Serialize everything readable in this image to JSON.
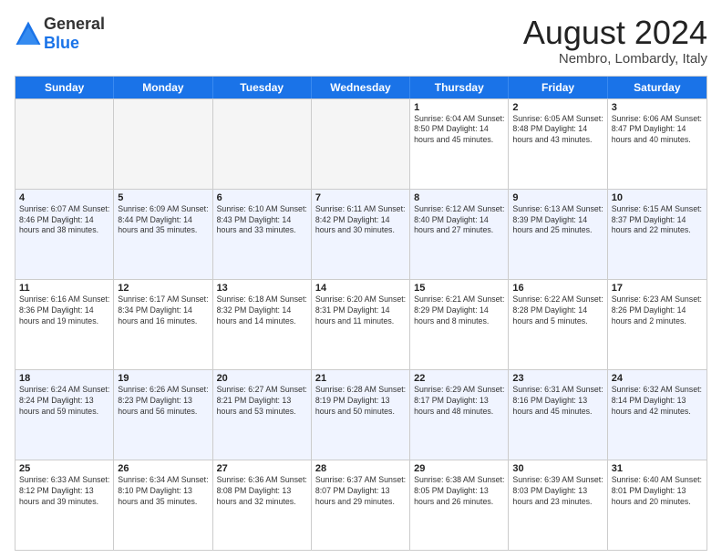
{
  "logo": {
    "general": "General",
    "blue": "Blue"
  },
  "title": "August 2024",
  "location": "Nembro, Lombardy, Italy",
  "days": [
    "Sunday",
    "Monday",
    "Tuesday",
    "Wednesday",
    "Thursday",
    "Friday",
    "Saturday"
  ],
  "rows": [
    [
      {
        "day": "",
        "info": "",
        "empty": true
      },
      {
        "day": "",
        "info": "",
        "empty": true
      },
      {
        "day": "",
        "info": "",
        "empty": true
      },
      {
        "day": "",
        "info": "",
        "empty": true
      },
      {
        "day": "1",
        "info": "Sunrise: 6:04 AM\nSunset: 8:50 PM\nDaylight: 14 hours\nand 45 minutes."
      },
      {
        "day": "2",
        "info": "Sunrise: 6:05 AM\nSunset: 8:48 PM\nDaylight: 14 hours\nand 43 minutes."
      },
      {
        "day": "3",
        "info": "Sunrise: 6:06 AM\nSunset: 8:47 PM\nDaylight: 14 hours\nand 40 minutes."
      }
    ],
    [
      {
        "day": "4",
        "info": "Sunrise: 6:07 AM\nSunset: 8:46 PM\nDaylight: 14 hours\nand 38 minutes."
      },
      {
        "day": "5",
        "info": "Sunrise: 6:09 AM\nSunset: 8:44 PM\nDaylight: 14 hours\nand 35 minutes."
      },
      {
        "day": "6",
        "info": "Sunrise: 6:10 AM\nSunset: 8:43 PM\nDaylight: 14 hours\nand 33 minutes."
      },
      {
        "day": "7",
        "info": "Sunrise: 6:11 AM\nSunset: 8:42 PM\nDaylight: 14 hours\nand 30 minutes."
      },
      {
        "day": "8",
        "info": "Sunrise: 6:12 AM\nSunset: 8:40 PM\nDaylight: 14 hours\nand 27 minutes."
      },
      {
        "day": "9",
        "info": "Sunrise: 6:13 AM\nSunset: 8:39 PM\nDaylight: 14 hours\nand 25 minutes."
      },
      {
        "day": "10",
        "info": "Sunrise: 6:15 AM\nSunset: 8:37 PM\nDaylight: 14 hours\nand 22 minutes."
      }
    ],
    [
      {
        "day": "11",
        "info": "Sunrise: 6:16 AM\nSunset: 8:36 PM\nDaylight: 14 hours\nand 19 minutes."
      },
      {
        "day": "12",
        "info": "Sunrise: 6:17 AM\nSunset: 8:34 PM\nDaylight: 14 hours\nand 16 minutes."
      },
      {
        "day": "13",
        "info": "Sunrise: 6:18 AM\nSunset: 8:32 PM\nDaylight: 14 hours\nand 14 minutes."
      },
      {
        "day": "14",
        "info": "Sunrise: 6:20 AM\nSunset: 8:31 PM\nDaylight: 14 hours\nand 11 minutes."
      },
      {
        "day": "15",
        "info": "Sunrise: 6:21 AM\nSunset: 8:29 PM\nDaylight: 14 hours\nand 8 minutes."
      },
      {
        "day": "16",
        "info": "Sunrise: 6:22 AM\nSunset: 8:28 PM\nDaylight: 14 hours\nand 5 minutes."
      },
      {
        "day": "17",
        "info": "Sunrise: 6:23 AM\nSunset: 8:26 PM\nDaylight: 14 hours\nand 2 minutes."
      }
    ],
    [
      {
        "day": "18",
        "info": "Sunrise: 6:24 AM\nSunset: 8:24 PM\nDaylight: 13 hours\nand 59 minutes."
      },
      {
        "day": "19",
        "info": "Sunrise: 6:26 AM\nSunset: 8:23 PM\nDaylight: 13 hours\nand 56 minutes."
      },
      {
        "day": "20",
        "info": "Sunrise: 6:27 AM\nSunset: 8:21 PM\nDaylight: 13 hours\nand 53 minutes."
      },
      {
        "day": "21",
        "info": "Sunrise: 6:28 AM\nSunset: 8:19 PM\nDaylight: 13 hours\nand 50 minutes."
      },
      {
        "day": "22",
        "info": "Sunrise: 6:29 AM\nSunset: 8:17 PM\nDaylight: 13 hours\nand 48 minutes."
      },
      {
        "day": "23",
        "info": "Sunrise: 6:31 AM\nSunset: 8:16 PM\nDaylight: 13 hours\nand 45 minutes."
      },
      {
        "day": "24",
        "info": "Sunrise: 6:32 AM\nSunset: 8:14 PM\nDaylight: 13 hours\nand 42 minutes."
      }
    ],
    [
      {
        "day": "25",
        "info": "Sunrise: 6:33 AM\nSunset: 8:12 PM\nDaylight: 13 hours\nand 39 minutes."
      },
      {
        "day": "26",
        "info": "Sunrise: 6:34 AM\nSunset: 8:10 PM\nDaylight: 13 hours\nand 35 minutes."
      },
      {
        "day": "27",
        "info": "Sunrise: 6:36 AM\nSunset: 8:08 PM\nDaylight: 13 hours\nand 32 minutes."
      },
      {
        "day": "28",
        "info": "Sunrise: 6:37 AM\nSunset: 8:07 PM\nDaylight: 13 hours\nand 29 minutes."
      },
      {
        "day": "29",
        "info": "Sunrise: 6:38 AM\nSunset: 8:05 PM\nDaylight: 13 hours\nand 26 minutes."
      },
      {
        "day": "30",
        "info": "Sunrise: 6:39 AM\nSunset: 8:03 PM\nDaylight: 13 hours\nand 23 minutes."
      },
      {
        "day": "31",
        "info": "Sunrise: 6:40 AM\nSunset: 8:01 PM\nDaylight: 13 hours\nand 20 minutes."
      }
    ]
  ]
}
